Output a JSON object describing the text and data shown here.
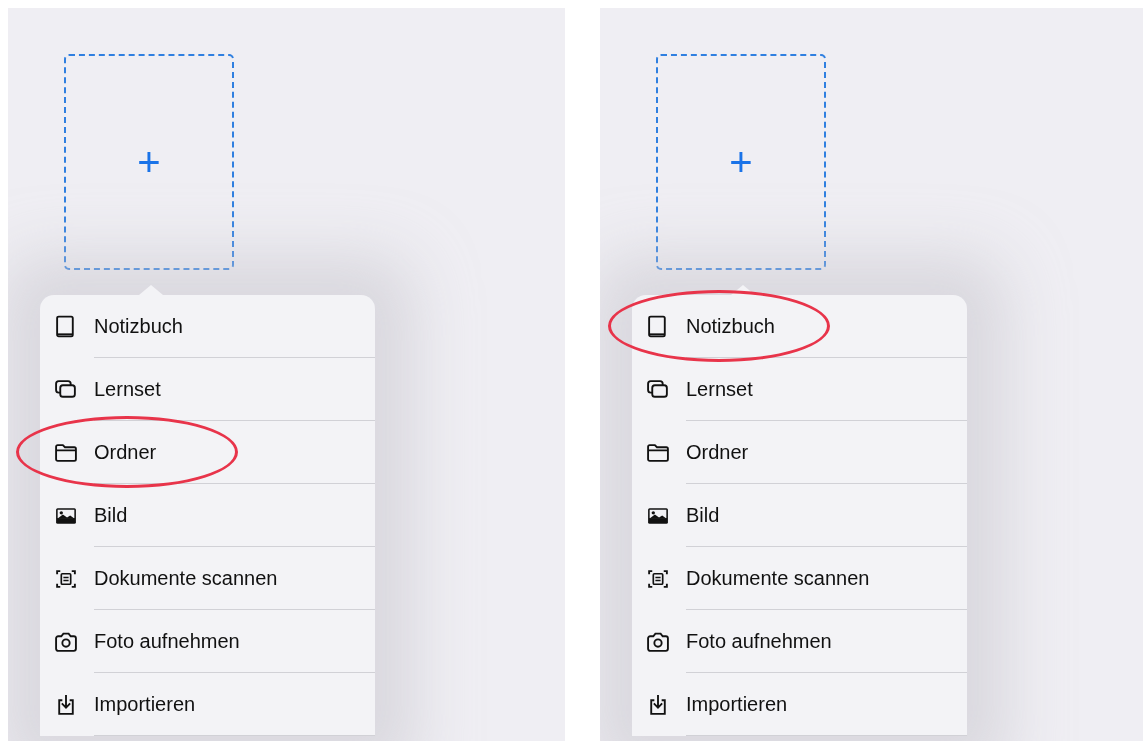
{
  "panels": [
    {
      "add_card": {
        "label": "+"
      },
      "items": [
        {
          "kind": "notebook",
          "label": "Notizbuch",
          "highlighted": false
        },
        {
          "kind": "cards",
          "label": "Lernset",
          "highlighted": false
        },
        {
          "kind": "folder",
          "label": "Ordner",
          "highlighted": true
        },
        {
          "kind": "image",
          "label": "Bild",
          "highlighted": false
        },
        {
          "kind": "scan",
          "label": "Dokumente scannen",
          "highlighted": false
        },
        {
          "kind": "camera",
          "label": "Foto aufnehmen",
          "highlighted": false
        },
        {
          "kind": "import",
          "label": "Importieren",
          "highlighted": false
        }
      ]
    },
    {
      "add_card": {
        "label": "+"
      },
      "items": [
        {
          "kind": "notebook",
          "label": "Notizbuch",
          "highlighted": true
        },
        {
          "kind": "cards",
          "label": "Lernset",
          "highlighted": false
        },
        {
          "kind": "folder",
          "label": "Ordner",
          "highlighted": false
        },
        {
          "kind": "image",
          "label": "Bild",
          "highlighted": false
        },
        {
          "kind": "scan",
          "label": "Dokumente scannen",
          "highlighted": false
        },
        {
          "kind": "camera",
          "label": "Foto aufnehmen",
          "highlighted": false
        },
        {
          "kind": "import",
          "label": "Importieren",
          "highlighted": false
        }
      ]
    }
  ]
}
